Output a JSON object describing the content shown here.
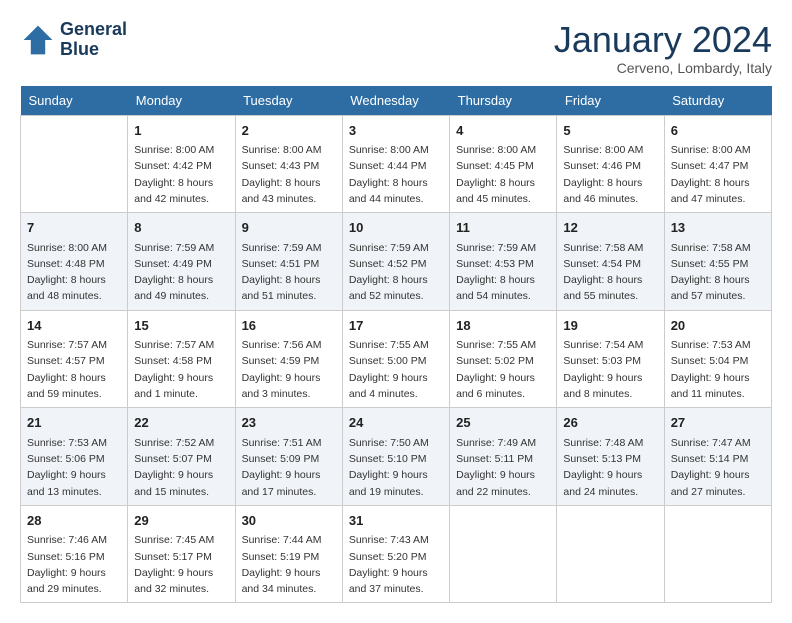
{
  "header": {
    "logo_line1": "General",
    "logo_line2": "Blue",
    "month": "January 2024",
    "location": "Cerveno, Lombardy, Italy"
  },
  "days_of_week": [
    "Sunday",
    "Monday",
    "Tuesday",
    "Wednesday",
    "Thursday",
    "Friday",
    "Saturday"
  ],
  "weeks": [
    [
      {
        "day": "",
        "info": ""
      },
      {
        "day": "1",
        "info": "Sunrise: 8:00 AM\nSunset: 4:42 PM\nDaylight: 8 hours\nand 42 minutes."
      },
      {
        "day": "2",
        "info": "Sunrise: 8:00 AM\nSunset: 4:43 PM\nDaylight: 8 hours\nand 43 minutes."
      },
      {
        "day": "3",
        "info": "Sunrise: 8:00 AM\nSunset: 4:44 PM\nDaylight: 8 hours\nand 44 minutes."
      },
      {
        "day": "4",
        "info": "Sunrise: 8:00 AM\nSunset: 4:45 PM\nDaylight: 8 hours\nand 45 minutes."
      },
      {
        "day": "5",
        "info": "Sunrise: 8:00 AM\nSunset: 4:46 PM\nDaylight: 8 hours\nand 46 minutes."
      },
      {
        "day": "6",
        "info": "Sunrise: 8:00 AM\nSunset: 4:47 PM\nDaylight: 8 hours\nand 47 minutes."
      }
    ],
    [
      {
        "day": "7",
        "info": "Sunrise: 8:00 AM\nSunset: 4:48 PM\nDaylight: 8 hours\nand 48 minutes."
      },
      {
        "day": "8",
        "info": "Sunrise: 7:59 AM\nSunset: 4:49 PM\nDaylight: 8 hours\nand 49 minutes."
      },
      {
        "day": "9",
        "info": "Sunrise: 7:59 AM\nSunset: 4:51 PM\nDaylight: 8 hours\nand 51 minutes."
      },
      {
        "day": "10",
        "info": "Sunrise: 7:59 AM\nSunset: 4:52 PM\nDaylight: 8 hours\nand 52 minutes."
      },
      {
        "day": "11",
        "info": "Sunrise: 7:59 AM\nSunset: 4:53 PM\nDaylight: 8 hours\nand 54 minutes."
      },
      {
        "day": "12",
        "info": "Sunrise: 7:58 AM\nSunset: 4:54 PM\nDaylight: 8 hours\nand 55 minutes."
      },
      {
        "day": "13",
        "info": "Sunrise: 7:58 AM\nSunset: 4:55 PM\nDaylight: 8 hours\nand 57 minutes."
      }
    ],
    [
      {
        "day": "14",
        "info": "Sunrise: 7:57 AM\nSunset: 4:57 PM\nDaylight: 8 hours\nand 59 minutes."
      },
      {
        "day": "15",
        "info": "Sunrise: 7:57 AM\nSunset: 4:58 PM\nDaylight: 9 hours\nand 1 minute."
      },
      {
        "day": "16",
        "info": "Sunrise: 7:56 AM\nSunset: 4:59 PM\nDaylight: 9 hours\nand 3 minutes."
      },
      {
        "day": "17",
        "info": "Sunrise: 7:55 AM\nSunset: 5:00 PM\nDaylight: 9 hours\nand 4 minutes."
      },
      {
        "day": "18",
        "info": "Sunrise: 7:55 AM\nSunset: 5:02 PM\nDaylight: 9 hours\nand 6 minutes."
      },
      {
        "day": "19",
        "info": "Sunrise: 7:54 AM\nSunset: 5:03 PM\nDaylight: 9 hours\nand 8 minutes."
      },
      {
        "day": "20",
        "info": "Sunrise: 7:53 AM\nSunset: 5:04 PM\nDaylight: 9 hours\nand 11 minutes."
      }
    ],
    [
      {
        "day": "21",
        "info": "Sunrise: 7:53 AM\nSunset: 5:06 PM\nDaylight: 9 hours\nand 13 minutes."
      },
      {
        "day": "22",
        "info": "Sunrise: 7:52 AM\nSunset: 5:07 PM\nDaylight: 9 hours\nand 15 minutes."
      },
      {
        "day": "23",
        "info": "Sunrise: 7:51 AM\nSunset: 5:09 PM\nDaylight: 9 hours\nand 17 minutes."
      },
      {
        "day": "24",
        "info": "Sunrise: 7:50 AM\nSunset: 5:10 PM\nDaylight: 9 hours\nand 19 minutes."
      },
      {
        "day": "25",
        "info": "Sunrise: 7:49 AM\nSunset: 5:11 PM\nDaylight: 9 hours\nand 22 minutes."
      },
      {
        "day": "26",
        "info": "Sunrise: 7:48 AM\nSunset: 5:13 PM\nDaylight: 9 hours\nand 24 minutes."
      },
      {
        "day": "27",
        "info": "Sunrise: 7:47 AM\nSunset: 5:14 PM\nDaylight: 9 hours\nand 27 minutes."
      }
    ],
    [
      {
        "day": "28",
        "info": "Sunrise: 7:46 AM\nSunset: 5:16 PM\nDaylight: 9 hours\nand 29 minutes."
      },
      {
        "day": "29",
        "info": "Sunrise: 7:45 AM\nSunset: 5:17 PM\nDaylight: 9 hours\nand 32 minutes."
      },
      {
        "day": "30",
        "info": "Sunrise: 7:44 AM\nSunset: 5:19 PM\nDaylight: 9 hours\nand 34 minutes."
      },
      {
        "day": "31",
        "info": "Sunrise: 7:43 AM\nSunset: 5:20 PM\nDaylight: 9 hours\nand 37 minutes."
      },
      {
        "day": "",
        "info": ""
      },
      {
        "day": "",
        "info": ""
      },
      {
        "day": "",
        "info": ""
      }
    ]
  ]
}
